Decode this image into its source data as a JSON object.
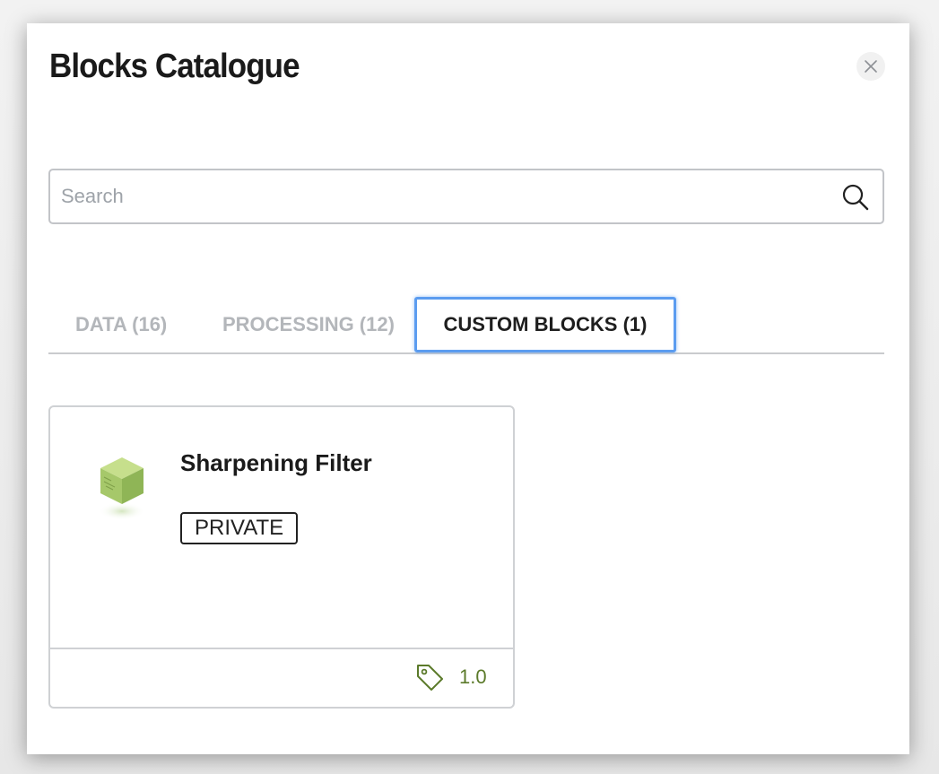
{
  "modal": {
    "title": "Blocks Catalogue",
    "close_icon": "close-icon"
  },
  "search": {
    "placeholder": "Search",
    "value": "",
    "icon": "search-icon"
  },
  "tabs": [
    {
      "label": "DATA (16)",
      "active": false
    },
    {
      "label": "PROCESSING (12)",
      "active": false
    },
    {
      "label": "CUSTOM BLOCKS (1)",
      "active": true
    }
  ],
  "blocks": [
    {
      "name": "Sharpening Filter",
      "icon": "green-cube-icon",
      "visibility": "PRIVATE",
      "version_icon": "tag-icon",
      "version": "1.0"
    }
  ],
  "colors": {
    "active_tab_border": "#5b9cf0",
    "inactive_tab_text": "#b3b6ba",
    "version_text": "#5b7a2a",
    "block_icon": "#a6c86a"
  }
}
